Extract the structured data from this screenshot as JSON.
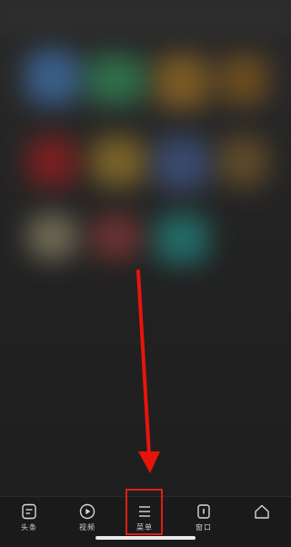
{
  "tabs": [
    {
      "label": "头条",
      "icon": "news-icon"
    },
    {
      "label": "视频",
      "icon": "play-icon"
    },
    {
      "label": "菜单",
      "icon": "menu-icon"
    },
    {
      "label": "窗口",
      "icon": "window-icon"
    },
    {
      "label": "",
      "icon": "home-icon"
    }
  ],
  "colors": {
    "highlight": "#e01e14",
    "tabbar_bg": "#1a1a1a",
    "label": "#cfcfcf"
  }
}
